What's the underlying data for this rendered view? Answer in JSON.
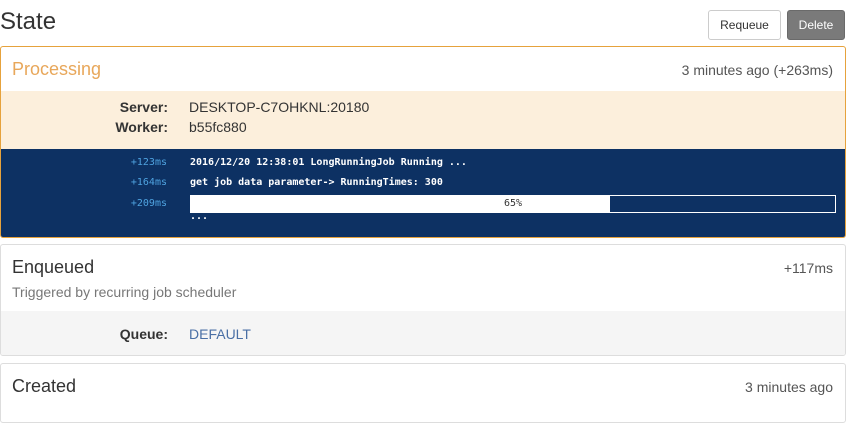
{
  "header": {
    "title": "State",
    "requeue_label": "Requeue",
    "delete_label": "Delete"
  },
  "processing": {
    "title": "Processing",
    "time": "3 minutes ago (+263ms)",
    "accent": "#e8a75a",
    "server_label": "Server:",
    "server_value": "DESKTOP-C7OHKNL:20180",
    "worker_label": "Worker:",
    "worker_value": "b55fc880",
    "console": {
      "lines": [
        {
          "time": "+123ms",
          "text": "2016/12/20 12:38:01 LongRunningJob Running ..."
        },
        {
          "time": "+164ms",
          "text": "get job data parameter-> RunningTimes: 300"
        },
        {
          "time": "+209ms"
        }
      ],
      "progress_percent": 65,
      "progress_label": "65%",
      "ellipsis": "..."
    }
  },
  "enqueued": {
    "title": "Enqueued",
    "time": "+117ms",
    "subtitle": "Triggered by recurring job scheduler",
    "queue_label": "Queue:",
    "queue_value": "DEFAULT"
  },
  "created": {
    "title": "Created",
    "time": "3 minutes ago"
  }
}
